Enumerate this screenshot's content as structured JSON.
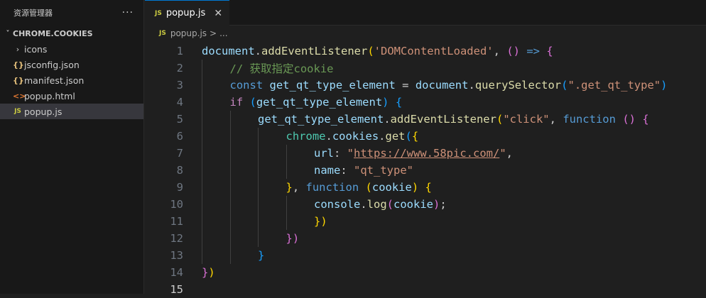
{
  "explorer": {
    "title": "资源管理器",
    "more": "···",
    "section": "CHROME.COOKIES",
    "items": [
      {
        "label": "icons",
        "icon": "chevron-right-icon",
        "glyph": "›"
      },
      {
        "label": "jsconfig.json",
        "icon": "json-icon",
        "glyph": "{}"
      },
      {
        "label": "manifest.json",
        "icon": "json-icon",
        "glyph": "{}"
      },
      {
        "label": "popup.html",
        "icon": "html-icon",
        "glyph": "<>"
      },
      {
        "label": "popup.js",
        "icon": "js-icon",
        "glyph": "JS"
      }
    ],
    "chevron": "˅"
  },
  "tab": {
    "badge": "JS",
    "label": "popup.js",
    "close": "✕"
  },
  "breadcrumb": {
    "badge": "JS",
    "file": "popup.js",
    "sep": ">",
    "more": "..."
  },
  "colors": {
    "accent": "#0078d4",
    "js": "#cbcb41",
    "json": "#e5c07b",
    "html": "#e37933",
    "editor_bg": "#1f1f1f",
    "sidebar_bg": "#181818"
  },
  "code_lines": [
    {
      "n": "1",
      "indent": 0,
      "tokens": [
        [
          "document",
          "fn-var"
        ],
        [
          ".",
          "plain"
        ],
        [
          "addEventListener",
          "fn"
        ],
        [
          "(",
          "b1"
        ],
        [
          "'DOMContentLoaded'",
          "str"
        ],
        [
          ", ",
          "plain"
        ],
        [
          "()",
          "b2"
        ],
        [
          " => ",
          "kw"
        ],
        [
          "{",
          "b2"
        ]
      ]
    },
    {
      "n": "2",
      "indent": 1,
      "tokens": [
        [
          "// 获取指定cookie",
          "com"
        ]
      ]
    },
    {
      "n": "3",
      "indent": 1,
      "tokens": [
        [
          "const ",
          "kw"
        ],
        [
          "get_qt_type_element",
          "var"
        ],
        [
          " = ",
          "plain"
        ],
        [
          "document",
          "var"
        ],
        [
          ".",
          "plain"
        ],
        [
          "querySelector",
          "fn"
        ],
        [
          "(",
          "b3"
        ],
        [
          "\".get_qt_type\"",
          "str"
        ],
        [
          ")",
          "b3"
        ]
      ]
    },
    {
      "n": "4",
      "indent": 1,
      "tokens": [
        [
          "if ",
          "ctrl"
        ],
        [
          "(",
          "b3"
        ],
        [
          "get_qt_type_element",
          "var"
        ],
        [
          ") ",
          "b3"
        ],
        [
          "{",
          "b3"
        ]
      ]
    },
    {
      "n": "5",
      "indent": 2,
      "tokens": [
        [
          "get_qt_type_element",
          "var"
        ],
        [
          ".",
          "plain"
        ],
        [
          "addEventListener",
          "fn"
        ],
        [
          "(",
          "b1"
        ],
        [
          "\"click\"",
          "str"
        ],
        [
          ", ",
          "plain"
        ],
        [
          "function ",
          "kw"
        ],
        [
          "() ",
          "b2"
        ],
        [
          "{",
          "b2"
        ]
      ]
    },
    {
      "n": "6",
      "indent": 3,
      "tokens": [
        [
          "chrome",
          "cls"
        ],
        [
          ".",
          "plain"
        ],
        [
          "cookies",
          "var"
        ],
        [
          ".",
          "plain"
        ],
        [
          "get",
          "fn"
        ],
        [
          "(",
          "b3"
        ],
        [
          "{",
          "b1"
        ]
      ]
    },
    {
      "n": "7",
      "indent": 4,
      "tokens": [
        [
          "url",
          "var"
        ],
        [
          ": ",
          "plain"
        ],
        [
          "\"",
          "str"
        ],
        [
          "https://www.58pic.com/",
          "url"
        ],
        [
          "\"",
          "str"
        ],
        [
          ",",
          "plain"
        ]
      ]
    },
    {
      "n": "8",
      "indent": 4,
      "tokens": [
        [
          "name",
          "var"
        ],
        [
          ": ",
          "plain"
        ],
        [
          "\"qt_type\"",
          "str"
        ]
      ]
    },
    {
      "n": "9",
      "indent": 3,
      "tokens": [
        [
          "}",
          "b1"
        ],
        [
          ", ",
          "plain"
        ],
        [
          "function ",
          "kw"
        ],
        [
          "(",
          "b1"
        ],
        [
          "cookie",
          "var"
        ],
        [
          ") ",
          "b1"
        ],
        [
          "{",
          "b1"
        ]
      ]
    },
    {
      "n": "10",
      "indent": 4,
      "tokens": [
        [
          "console",
          "var"
        ],
        [
          ".",
          "plain"
        ],
        [
          "log",
          "fn"
        ],
        [
          "(",
          "b2"
        ],
        [
          "cookie",
          "var"
        ],
        [
          ")",
          "b2"
        ],
        [
          ";",
          "plain"
        ]
      ]
    },
    {
      "n": "11",
      "indent": 4,
      "tokens": [
        [
          "})",
          "b1"
        ]
      ]
    },
    {
      "n": "12",
      "indent": 3,
      "tokens": [
        [
          "})",
          "b2"
        ]
      ]
    },
    {
      "n": "13",
      "indent": 2,
      "tokens": [
        [
          "}",
          "b3"
        ]
      ]
    },
    {
      "n": "14",
      "indent": 0,
      "tokens": [
        [
          "}",
          "b2"
        ],
        [
          ")",
          "b1"
        ]
      ]
    },
    {
      "n": "15",
      "indent": 0,
      "tokens": []
    }
  ]
}
